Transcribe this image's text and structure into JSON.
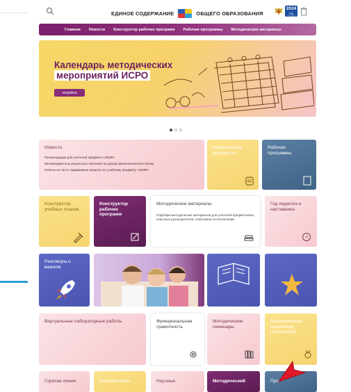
{
  "header": {
    "title_left": "ЕДИНОЕ СОДЕРЖАНИЕ",
    "title_right": "ОБЩЕГО ОБРАЗОВАНИЯ",
    "badge_year": "2024",
    "badge_sub": "ГОД СЕМЬИ"
  },
  "nav": {
    "items": [
      "Главная",
      "Новости",
      "Конструктор рабочих программ",
      "Рабочие программы",
      "Методические материалы"
    ]
  },
  "banner": {
    "line1": "Календарь методических",
    "line2": "мероприятий ИСРО",
    "button": "перейти"
  },
  "tiles": {
    "news": {
      "title": "Новости",
      "items": [
        "Рекомендации для учителей предмета «ОБЗР»",
        "Метапредметные результаты обучения на уроках филологического блока",
        "Ответы на часто задаваемые вопросы по учебному предмету «ОБЗР»"
      ]
    },
    "normative": "Нормативные документы",
    "programs": "Рабочие программы",
    "plan_constructor": "Конструктор учебных планов",
    "program_constructor": "Конструктор рабочих программ",
    "materials_title": "Методические материалы",
    "materials_desc": "Подборки методических материалов для учителей-предметников, классных руководителей, советников по воспитанию",
    "year_teacher": "Год педагога и наставника",
    "important": "Разговоры о важном",
    "labs": "Виртуальные лабораторные работы",
    "literacy": "Функциональная грамотность",
    "seminars": "Методические семинары",
    "olympiad": "Всероссийская олимпиада школьников",
    "hotline": "Горячая линия",
    "method2": "Методические",
    "science": "Научные",
    "method3": "Методический",
    "pro": "Про"
  },
  "colors": {
    "accent": "#7a1f6b",
    "banner_yellow": "#f6d766",
    "tile_blue": "#4a6d92",
    "tile_indigo": "#5560bc",
    "cursor_red": "#e0192a"
  }
}
